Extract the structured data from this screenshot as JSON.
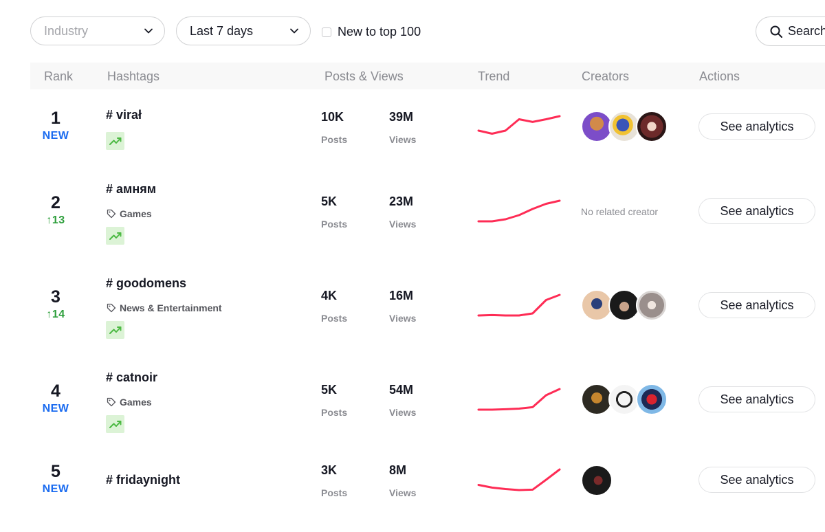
{
  "filters": {
    "industry_placeholder": "Industry",
    "period_value": "Last 7 days",
    "new_to_top_label": "New to top 100",
    "search_label": "Search"
  },
  "table": {
    "headers": {
      "rank": "Rank",
      "hashtags": "Hashtags",
      "posts_views": "Posts & Views",
      "trend": "Trend",
      "creators": "Creators",
      "actions": "Actions"
    },
    "posts_label": "Posts",
    "views_label": "Views",
    "action_label": "See analytics",
    "no_creator_text": "No related creator",
    "rows": [
      {
        "rank": "1",
        "badge": "NEW",
        "badge_type": "new",
        "hashtag": "# virał",
        "category": "",
        "posts": "10K",
        "views": "39M",
        "trend": [
          0.3,
          0.15,
          0.3,
          0.85,
          0.72,
          0.85,
          1.0
        ],
        "creators": [
          "avatar-1-1",
          "avatar-1-2",
          "avatar-1-3"
        ]
      },
      {
        "rank": "2",
        "badge": "↑13",
        "badge_type": "up",
        "hashtag": "# амням",
        "category": "Games",
        "posts": "5K",
        "views": "23M",
        "trend": [
          0.0,
          0.0,
          0.1,
          0.3,
          0.6,
          0.85,
          1.0
        ],
        "creators": []
      },
      {
        "rank": "3",
        "badge": "↑14",
        "badge_type": "up",
        "hashtag": "# goodomens",
        "category": "News & Entertainment",
        "posts": "4K",
        "views": "16M",
        "trend": [
          0.0,
          0.02,
          0.0,
          0.0,
          0.1,
          0.75,
          1.0
        ],
        "creators": [
          "avatar-3-1",
          "avatar-3-2",
          "avatar-3-3"
        ]
      },
      {
        "rank": "4",
        "badge": "NEW",
        "badge_type": "new",
        "hashtag": "# catnoir",
        "category": "Games",
        "posts": "5K",
        "views": "54M",
        "trend": [
          0.0,
          0.0,
          0.02,
          0.05,
          0.12,
          0.7,
          1.0
        ],
        "creators": [
          "avatar-4-1",
          "avatar-4-2",
          "avatar-4-3"
        ]
      },
      {
        "rank": "5",
        "badge": "NEW",
        "badge_type": "new",
        "hashtag": "# fridaynight",
        "category": "",
        "posts": "3K",
        "views": "8M",
        "trend": [
          0.25,
          0.12,
          0.05,
          0.0,
          0.02,
          0.5,
          1.0
        ],
        "creators": [
          "avatar-5-1"
        ]
      }
    ]
  },
  "colors": {
    "trend_line": "#fe2c55",
    "new_badge": "#1a6bf0",
    "up_badge": "#2e9f3c",
    "trend_icon_bg": "#dcf3d6",
    "trend_icon": "#4cb943"
  },
  "icons": {
    "dropdown": "chevron-down-icon",
    "search": "search-icon",
    "category": "tag-icon",
    "trend": "trending-up-icon"
  }
}
